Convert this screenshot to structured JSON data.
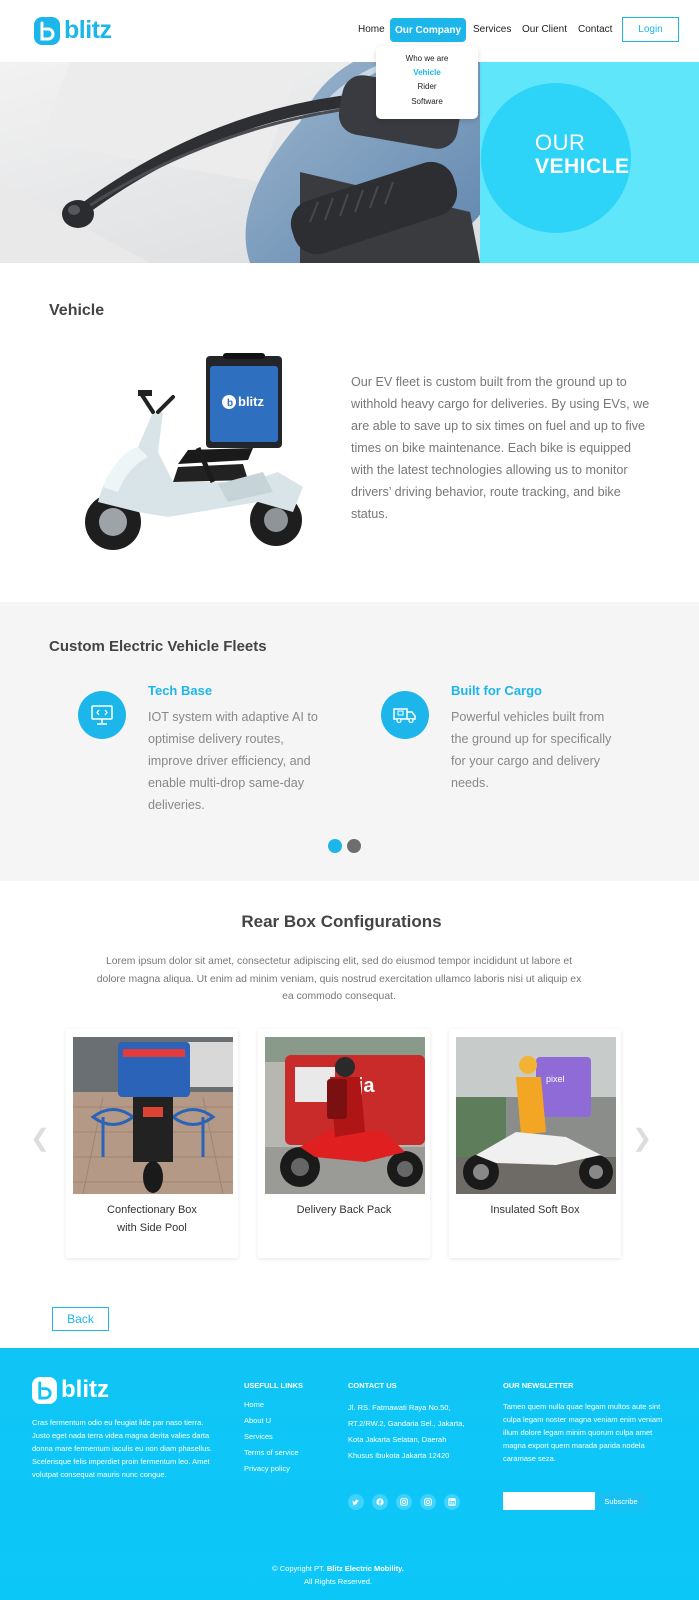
{
  "brand": {
    "name": "blitz",
    "accent": "#1cb6ea",
    "hero_cyan": "#5fe6fb"
  },
  "nav": {
    "items": [
      "Home",
      "Our Company",
      "Services",
      "Our Client",
      "Contact"
    ],
    "active": "Our Company",
    "login_label": "Login",
    "dropdown": [
      "Who we are",
      "Vehicle",
      "Rider",
      "Software"
    ],
    "dropdown_active": "Vehicle"
  },
  "hero": {
    "line1": "OUR",
    "line2": "VEHICLE"
  },
  "vehicle": {
    "title": "Vehicle",
    "paragraph": "Our EV fleet is custom built from the ground up to withhold heavy cargo for deliveries. By using EVs, we are able to save up to six times on fuel and up to five times on bike maintenance. Each bike is equipped with the latest technologies allowing us to monitor drivers’ driving behavior, route tracking, and bike status.",
    "image_box_brand": "blitz"
  },
  "fleets": {
    "title": "Custom Electric Vehicle Fleets",
    "features": [
      {
        "icon": "computer-icon",
        "title": "Tech Base",
        "text": "IOT system with adaptive AI to optimise delivery routes, improve driver efficiency, and enable multi-drop same-day deliveries."
      },
      {
        "icon": "truck-icon",
        "title": "Built for Cargo",
        "text": "Powerful vehicles built from the ground up for specifically for your cargo and delivery needs."
      }
    ],
    "carousel": {
      "active_dot": 0,
      "dot_count": 2
    }
  },
  "rear_box": {
    "title": "Rear Box Configurations",
    "paragraph": "Lorem ipsum dolor sit amet, consectetur adipiscing elit, sed do eiusmod tempor incididunt ut labore et dolore magna aliqua. Ut enim ad minim veniam, quis nostrud exercitation ullamco laboris nisi ut aliquip ex ea commodo consequat.",
    "cards": [
      {
        "caption_line1": "Confectionary Box",
        "caption_line2": "with Side Pool"
      },
      {
        "caption_line1": "Delivery Back Pack",
        "caption_line2": ""
      },
      {
        "caption_line1": "Insulated Soft Box",
        "caption_line2": ""
      }
    ],
    "card2_sign": "inja",
    "card3_sign": "pixel",
    "back_label": "Back"
  },
  "footer": {
    "about": "Cras fermentum odio eu feugiat lide par naso tierra. Justo eget nada terra videa magna derita valies darta donna mare fermentum iaculis eu non diam phasellus. Scelerisque felis imperdiet proin fermentum leo. Amet volutpat consequat mauris nunc congue.",
    "links_title": "USEFULL LINKS",
    "links": [
      "Home",
      "About U",
      "Services",
      "Terms of service",
      "Privacy policy"
    ],
    "contact_title": "CONTACT US",
    "contact_address": "Jl. RS. Fatmawati Raya No.50, RT.2/RW.2, Gandaria Sel., Jakarta, Kota Jakarta Selatan, Daerah Khusus Ibukota Jakarta 12420",
    "newsletter_title": "OUR NEWSLETTER",
    "newsletter_text": "Tamen quem nulla quae legam multos aute sint culpa legam noster magna veniam enim veniam illum dolore legam minim quorum culpa amet magna export quem marada parida nodela caramase seza.",
    "subscribe_label": "Subscribe",
    "socials": [
      "twitter-icon",
      "facebook-icon",
      "instagram-icon",
      "instagram-icon",
      "linkedin-icon"
    ],
    "copyright_prefix": "© Copyright PT. ",
    "copyright_company": "Blitz Electric Mobility.",
    "rights": "All Rights Reserved."
  }
}
